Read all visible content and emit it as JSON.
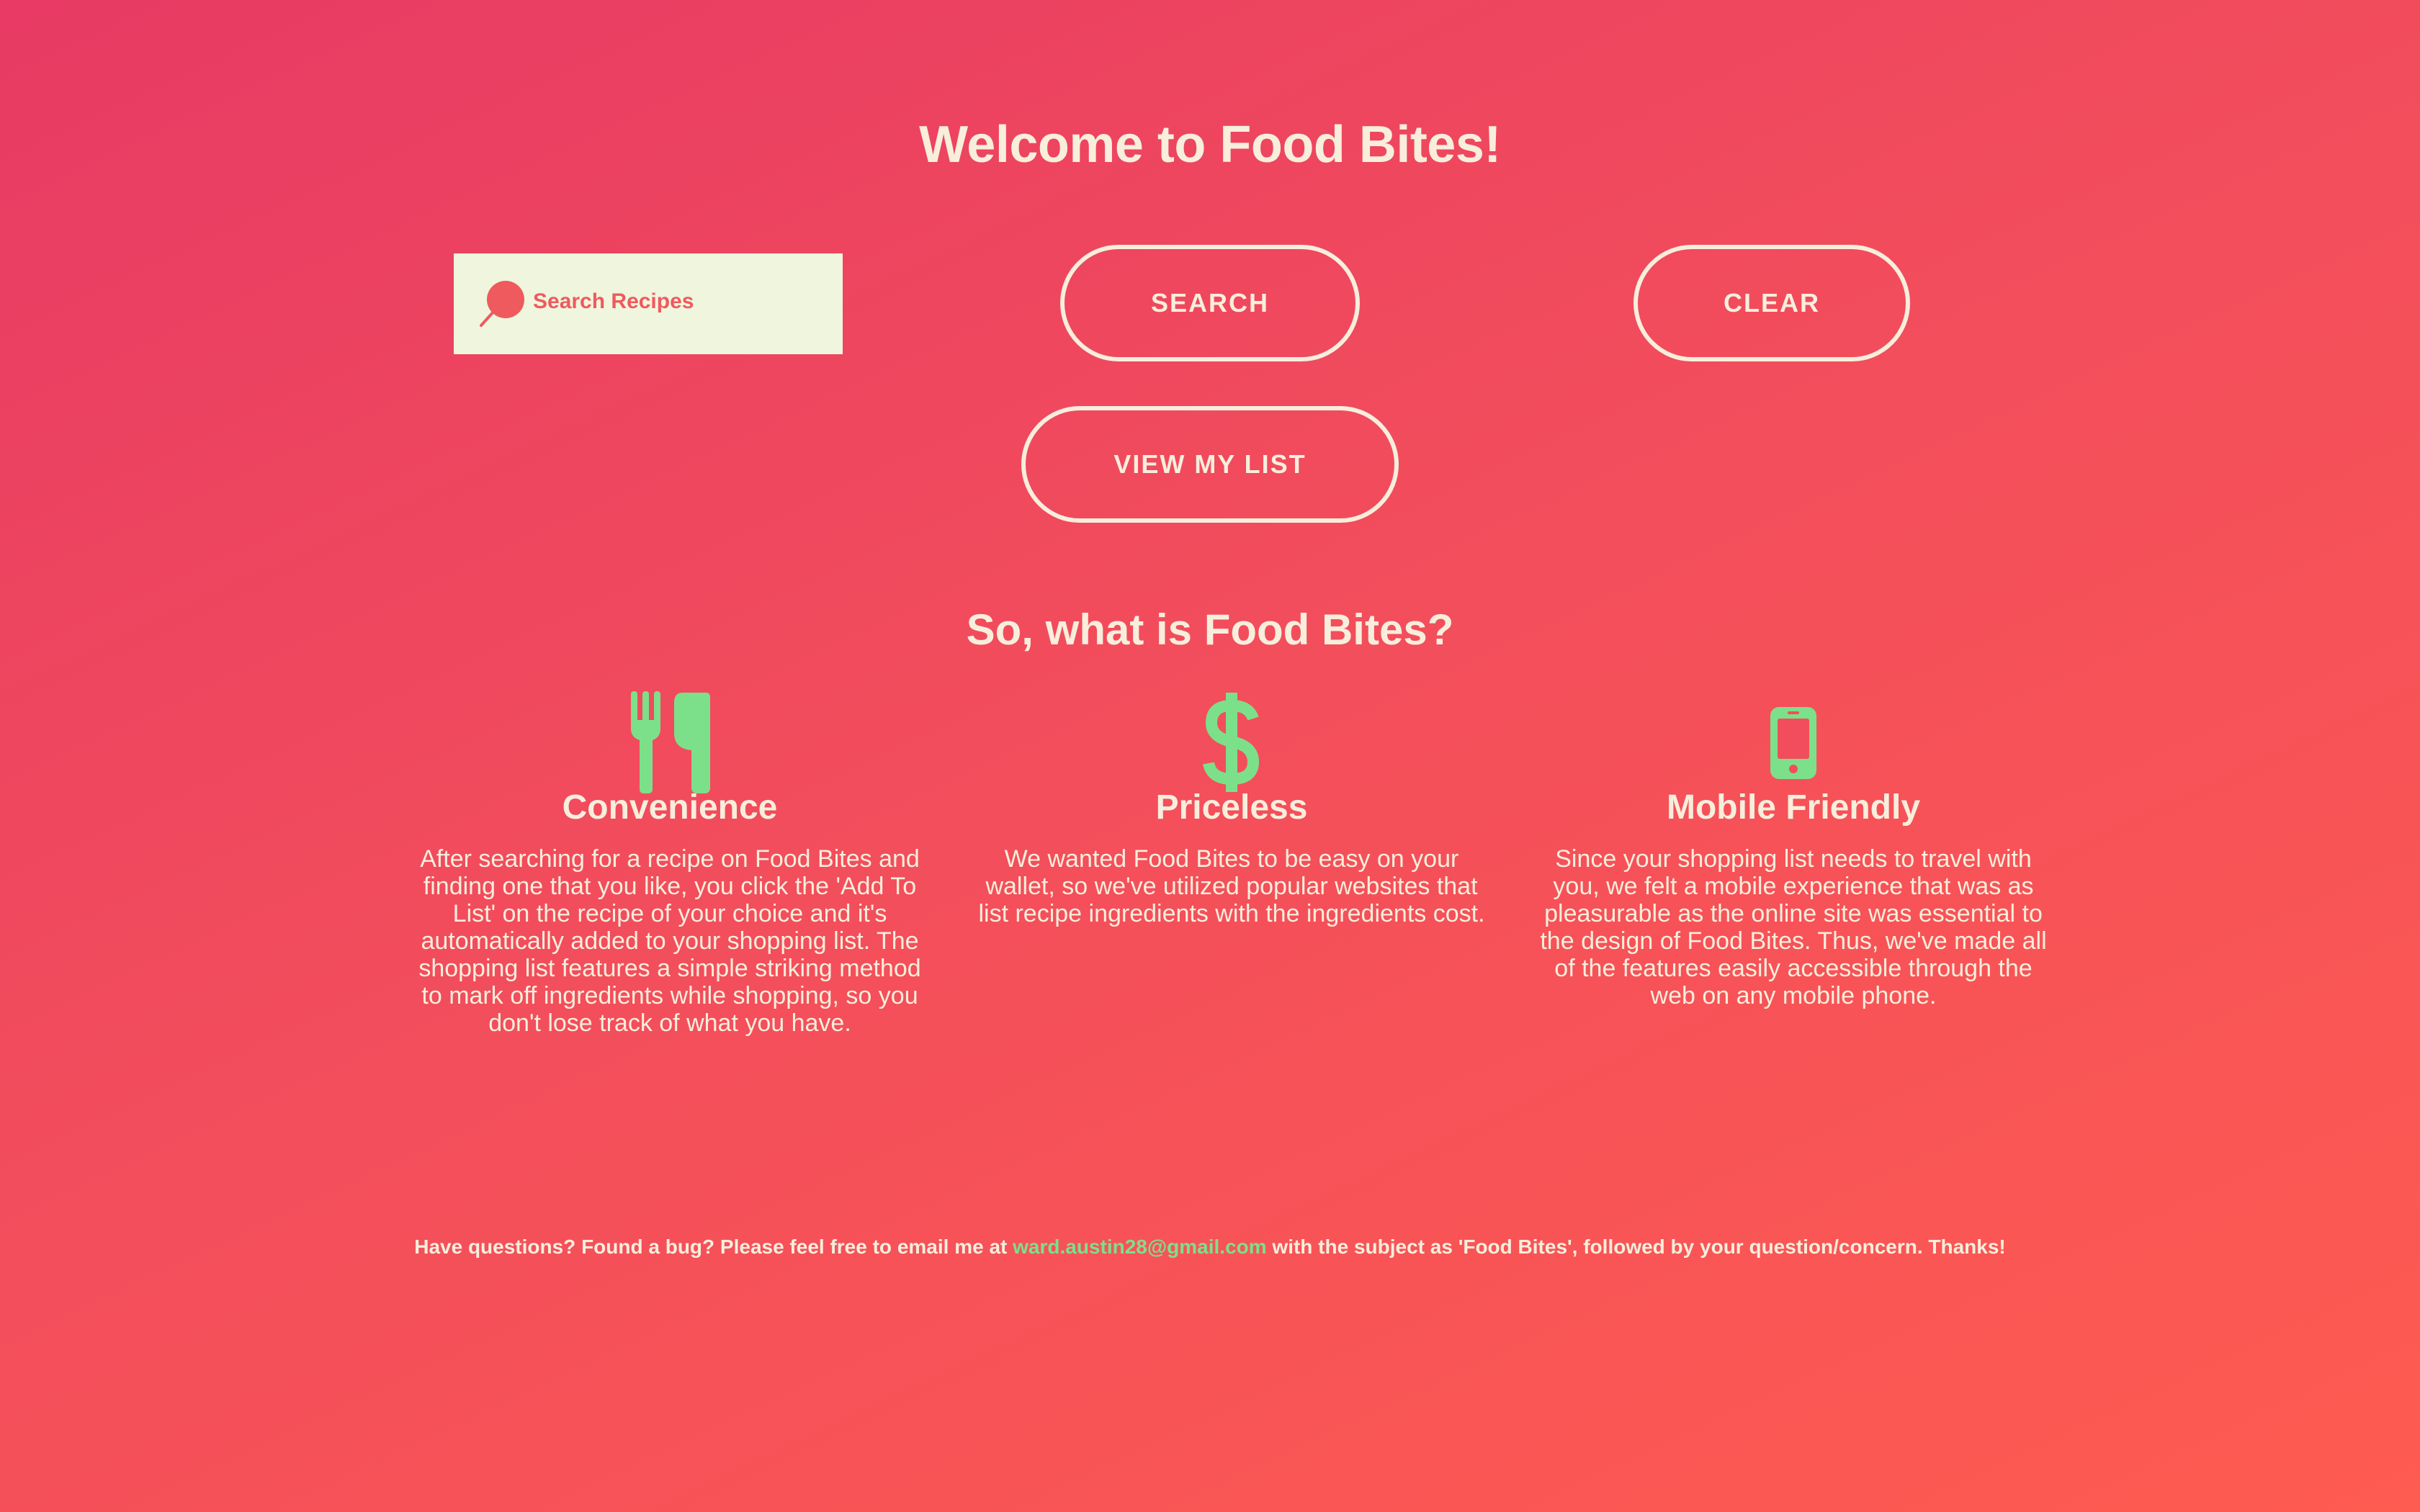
{
  "header": {
    "title": "Welcome to Food Bites!"
  },
  "search": {
    "icon": "lollipop-search-icon",
    "placeholder": "Search Recipes",
    "search_label": "SEARCH",
    "clear_label": "CLEAR",
    "view_list_label": "VIEW MY LIST"
  },
  "about": {
    "heading": "So, what is Food Bites?",
    "features": [
      {
        "icon": "fork-knife-icon",
        "title": "Convenience",
        "text": "After searching for a recipe on Food Bites and finding one that you like, you click the 'Add To List' on the recipe of your choice and it's automatically added to your shopping list. The shopping list features a simple striking method to mark off ingredients while shopping, so you don't lose track of what you have."
      },
      {
        "icon": "dollar-icon",
        "title": "Priceless",
        "text": "We wanted Food Bites to be easy on your wallet, so we've utilized popular websites that list recipe ingredients with the ingredients cost."
      },
      {
        "icon": "mobile-phone-icon",
        "title": "Mobile Friendly",
        "text": "Since your shopping list needs to travel with you, we felt a mobile experience that was as pleasurable as the online site was essential to the design of Food Bites. Thus, we've made all of the features easily accessible through the web on any mobile phone."
      }
    ]
  },
  "footer": {
    "text_before": "Have questions? Found a bug? Please feel free to email me at ",
    "email": "ward.austin28@gmail.com",
    "text_after": " with the subject as 'Food Bites', followed by your question/concern. Thanks!"
  },
  "colors": {
    "gradient_start": "#e83a64",
    "gradient_end": "#fe5b51",
    "text": "#f7eedc",
    "icon_green": "#7ce08a",
    "search_bg": "#eff6dd",
    "search_text": "#ef5a5e"
  }
}
